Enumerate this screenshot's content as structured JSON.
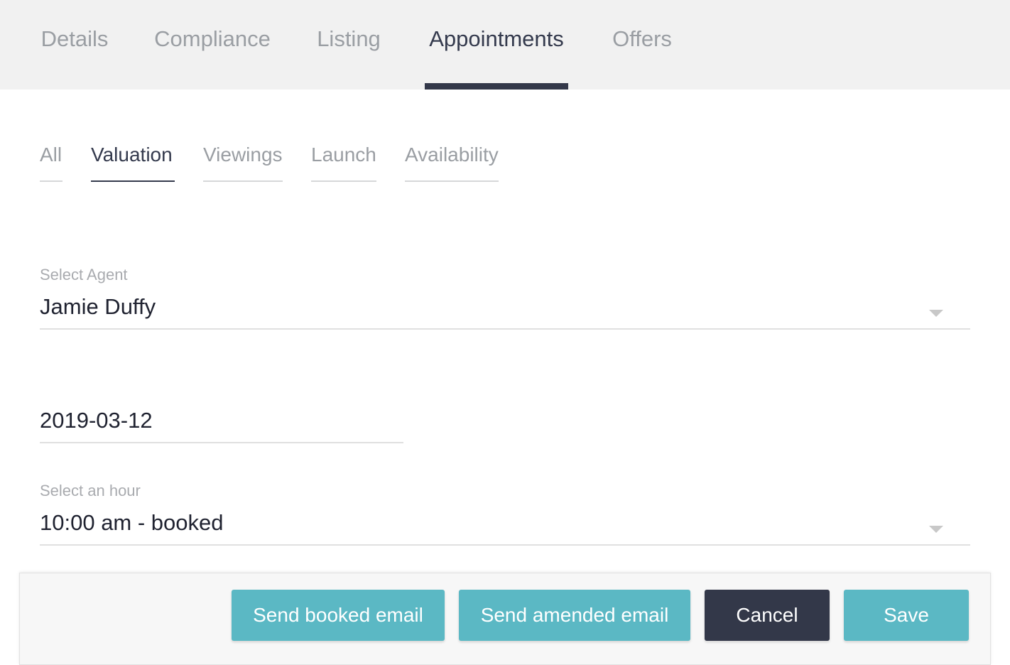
{
  "top_tabs": [
    {
      "label": "Details"
    },
    {
      "label": "Compliance"
    },
    {
      "label": "Listing"
    },
    {
      "label": "Appointments",
      "active": true
    },
    {
      "label": "Offers"
    }
  ],
  "sub_tabs": [
    {
      "label": "All"
    },
    {
      "label": "Valuation",
      "active": true
    },
    {
      "label": "Viewings"
    },
    {
      "label": "Launch"
    },
    {
      "label": "Availability"
    }
  ],
  "agent": {
    "label": "Select Agent",
    "value": "Jamie Duffy"
  },
  "date": {
    "value": "2019-03-12"
  },
  "hour": {
    "label": "Select an hour",
    "value": "10:00 am - booked"
  },
  "actions": {
    "send_booked": "Send booked email",
    "send_amended": "Send amended email",
    "cancel": "Cancel",
    "save": "Save"
  },
  "colors": {
    "accent": "#5bb8c4",
    "dark": "#333849",
    "topbar_bg": "#f1f1f1"
  }
}
